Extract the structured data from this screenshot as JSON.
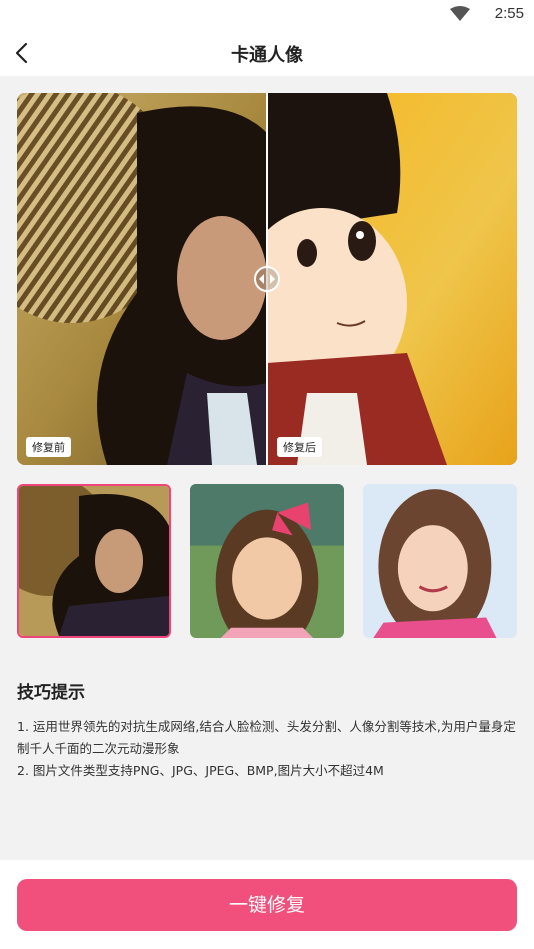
{
  "status_bar": {
    "time": "2:55",
    "wifi_icon": "wifi-icon"
  },
  "app_bar": {
    "back_icon": "back-arrow-icon",
    "title": "卡通人像"
  },
  "compare": {
    "before_label": "修复前",
    "after_label": "修复后",
    "handle_icon": "compare-slider-icon"
  },
  "thumbnails": [
    {
      "subject": "woman-with-straw-hat",
      "selected": true
    },
    {
      "subject": "girl-with-pink-bow",
      "selected": false
    },
    {
      "subject": "smiling-woman",
      "selected": false
    }
  ],
  "tips": {
    "title": "技巧提示",
    "line1": "1. 运用世界领先的对抗生成网络,结合人脸检测、头发分割、人像分割等技术,为用户量身定制千人千面的二次元动漫形象",
    "line2": "2. 图片文件类型支持PNG、JPG、JPEG、BMP,图片大小不超过4M"
  },
  "action": {
    "repair_label": "一键修复"
  },
  "colors": {
    "accent": "#f14f7c",
    "selected_border": "#f0457a",
    "background": "#f2f2f2"
  }
}
